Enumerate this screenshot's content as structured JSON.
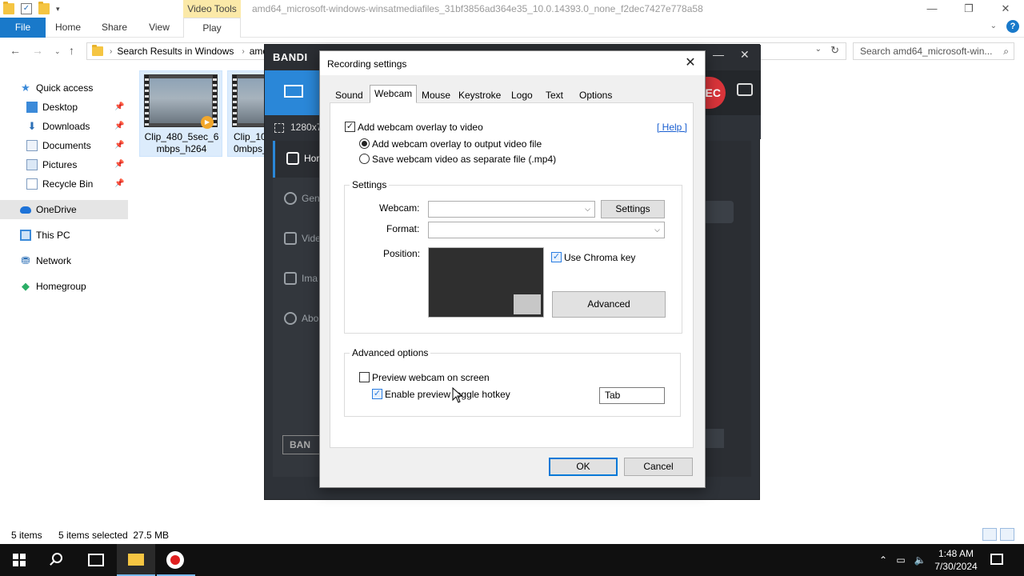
{
  "explorer": {
    "window_title": "amd64_microsoft-windows-winsatmediafiles_31bf3856ad364e35_10.0.14393.0_none_f2dec7427e778a58",
    "contextual_tab_group": "Video Tools",
    "ribbon_tabs": [
      "File",
      "Home",
      "Share",
      "View",
      "Play"
    ],
    "address": {
      "crumb1": "Search Results in Windows",
      "crumb2": "amd"
    },
    "search_placeholder": "Search amd64_microsoft-win...",
    "nav": [
      {
        "label": "Quick access",
        "icon": "star-icon",
        "pinned": false
      },
      {
        "label": "Desktop",
        "icon": "desktop-icon",
        "pinned": true
      },
      {
        "label": "Downloads",
        "icon": "download-icon",
        "pinned": true
      },
      {
        "label": "Documents",
        "icon": "documents-icon",
        "pinned": true
      },
      {
        "label": "Pictures",
        "icon": "pictures-icon",
        "pinned": true
      },
      {
        "label": "Recycle Bin",
        "icon": "recycle-bin-icon",
        "pinned": true
      },
      {
        "label": "OneDrive",
        "icon": "onedrive-icon",
        "pinned": false,
        "selected": true
      },
      {
        "label": "This PC",
        "icon": "computer-icon",
        "pinned": false
      },
      {
        "label": "Network",
        "icon": "network-icon",
        "pinned": false
      },
      {
        "label": "Homegroup",
        "icon": "homegroup-icon",
        "pinned": false
      }
    ],
    "files": [
      {
        "name_line1": "Clip_480_5sec_6",
        "name_line2": "mbps_h264"
      },
      {
        "name_line1": "Clip_10",
        "name_line2": "0mbps_"
      }
    ],
    "status": {
      "items": "5 items",
      "selected": "5 items selected  27.5 MB"
    }
  },
  "bandicam": {
    "logo": "BANDI",
    "rec_label": "EC",
    "resolution": "1280x7",
    "sidebar": [
      {
        "label": "Hor",
        "active": true
      },
      {
        "label": "Gen",
        "active": false
      },
      {
        "label": "Vide",
        "active": false
      },
      {
        "label": "Ima",
        "active": false
      },
      {
        "label": "Abo",
        "active": false
      }
    ],
    "bottom_logo": "BAN"
  },
  "dialog": {
    "title": "Recording settings",
    "tabs": [
      "Sound",
      "Webcam",
      "Mouse",
      "Keystroke",
      "Logo",
      "Text",
      "Options"
    ],
    "active_tab": "Webcam",
    "help_link": "[ Help ]",
    "overlay_checkbox": {
      "label": "Add webcam overlay to video",
      "checked": true
    },
    "radio_output": {
      "label": "Add webcam overlay to output video file",
      "selected": true
    },
    "radio_separate": {
      "label": "Save webcam video as separate file (.mp4)",
      "selected": false
    },
    "settings_group": {
      "title": "Settings",
      "webcam_label": "Webcam:",
      "webcam_value": "",
      "settings_button": "Settings",
      "format_label": "Format:",
      "format_value": "",
      "position_label": "Position:",
      "chroma_checkbox": {
        "label": "Use Chroma key",
        "checked": true
      },
      "advanced_button": "Advanced"
    },
    "advanced_group": {
      "title": "Advanced options",
      "preview_checkbox": {
        "label": "Preview webcam on screen",
        "checked": false
      },
      "hotkey_checkbox": {
        "label": "Enable preview toggle hotkey",
        "checked": true
      },
      "hotkey_value": "Tab"
    },
    "ok_button": "OK",
    "cancel_button": "Cancel"
  },
  "taskbar": {
    "time": "1:48 AM",
    "date": "7/30/2024"
  }
}
